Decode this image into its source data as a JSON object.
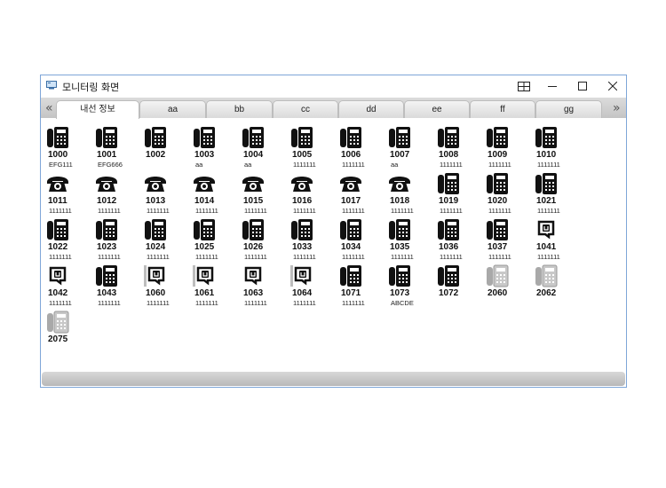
{
  "window": {
    "title": "모니터링 화면",
    "icons": {
      "app": "monitor-icon",
      "layout": "layout-icon",
      "minimize": "minimize-icon",
      "maximize": "maximize-icon",
      "close": "close-icon"
    }
  },
  "tabs": {
    "prev": "«",
    "next": "»",
    "items": [
      {
        "label": "내선 정보",
        "active": true
      },
      {
        "label": "aa"
      },
      {
        "label": "bb"
      },
      {
        "label": "cc"
      },
      {
        "label": "dd"
      },
      {
        "label": "ee"
      },
      {
        "label": "ff"
      },
      {
        "label": "gg"
      }
    ]
  },
  "extensions": [
    {
      "number": "1000",
      "label": "EFG111",
      "type": "desk"
    },
    {
      "number": "1001",
      "label": "EFG666",
      "type": "desk"
    },
    {
      "number": "1002",
      "label": "",
      "type": "desk"
    },
    {
      "number": "1003",
      "label": "aa",
      "type": "desk"
    },
    {
      "number": "1004",
      "label": "aa",
      "type": "desk"
    },
    {
      "number": "1005",
      "label": "1111111",
      "type": "desk"
    },
    {
      "number": "1006",
      "label": "1111111",
      "type": "desk"
    },
    {
      "number": "1007",
      "label": "aa",
      "type": "desk"
    },
    {
      "number": "1008",
      "label": "1111111",
      "type": "desk"
    },
    {
      "number": "1009",
      "label": "1111111",
      "type": "desk"
    },
    {
      "number": "1010",
      "label": "1111111",
      "type": "desk"
    },
    {
      "number": "1011",
      "label": "1111111",
      "type": "rotary"
    },
    {
      "number": "1012",
      "label": "1111111",
      "type": "rotary"
    },
    {
      "number": "1013",
      "label": "1111111",
      "type": "rotary"
    },
    {
      "number": "1014",
      "label": "1111111",
      "type": "rotary"
    },
    {
      "number": "1015",
      "label": "1111111",
      "type": "rotary"
    },
    {
      "number": "1016",
      "label": "1111111",
      "type": "rotary"
    },
    {
      "number": "1017",
      "label": "1111111",
      "type": "rotary"
    },
    {
      "number": "1018",
      "label": "1111111",
      "type": "rotary"
    },
    {
      "number": "1019",
      "label": "1111111",
      "type": "desk"
    },
    {
      "number": "1020",
      "label": "1111111",
      "type": "desk"
    },
    {
      "number": "1021",
      "label": "1111111",
      "type": "desk"
    },
    {
      "number": "1022",
      "label": "1111111",
      "type": "desk"
    },
    {
      "number": "1023",
      "label": "1111111",
      "type": "desk"
    },
    {
      "number": "1024",
      "label": "1111111",
      "type": "desk"
    },
    {
      "number": "1025",
      "label": "1111111",
      "type": "desk"
    },
    {
      "number": "1026",
      "label": "1111111",
      "type": "desk"
    },
    {
      "number": "1033",
      "label": "1111111",
      "type": "desk"
    },
    {
      "number": "1034",
      "label": "1111111",
      "type": "desk"
    },
    {
      "number": "1035",
      "label": "1111111",
      "type": "desk"
    },
    {
      "number": "1036",
      "label": "1111111",
      "type": "desk"
    },
    {
      "number": "1037",
      "label": "1111111",
      "type": "desk"
    },
    {
      "number": "1041",
      "label": "1111111",
      "type": "forward"
    },
    {
      "number": "1042",
      "label": "1111111",
      "type": "forward"
    },
    {
      "number": "1043",
      "label": "1111111",
      "type": "desk"
    },
    {
      "number": "1060",
      "label": "1111111",
      "type": "forward-bar"
    },
    {
      "number": "1061",
      "label": "1111111",
      "type": "forward-bar"
    },
    {
      "number": "1063",
      "label": "1111111",
      "type": "forward"
    },
    {
      "number": "1064",
      "label": "1111111",
      "type": "forward-bar"
    },
    {
      "number": "1071",
      "label": "1111111",
      "type": "desk"
    },
    {
      "number": "1073",
      "label": "ABCDE",
      "type": "desk"
    },
    {
      "number": "1072",
      "label": "",
      "type": "desk"
    },
    {
      "number": "2060",
      "label": "",
      "type": "gray"
    },
    {
      "number": "2062",
      "label": "",
      "type": "gray"
    },
    {
      "number": "2075",
      "label": "",
      "type": "gray"
    }
  ]
}
